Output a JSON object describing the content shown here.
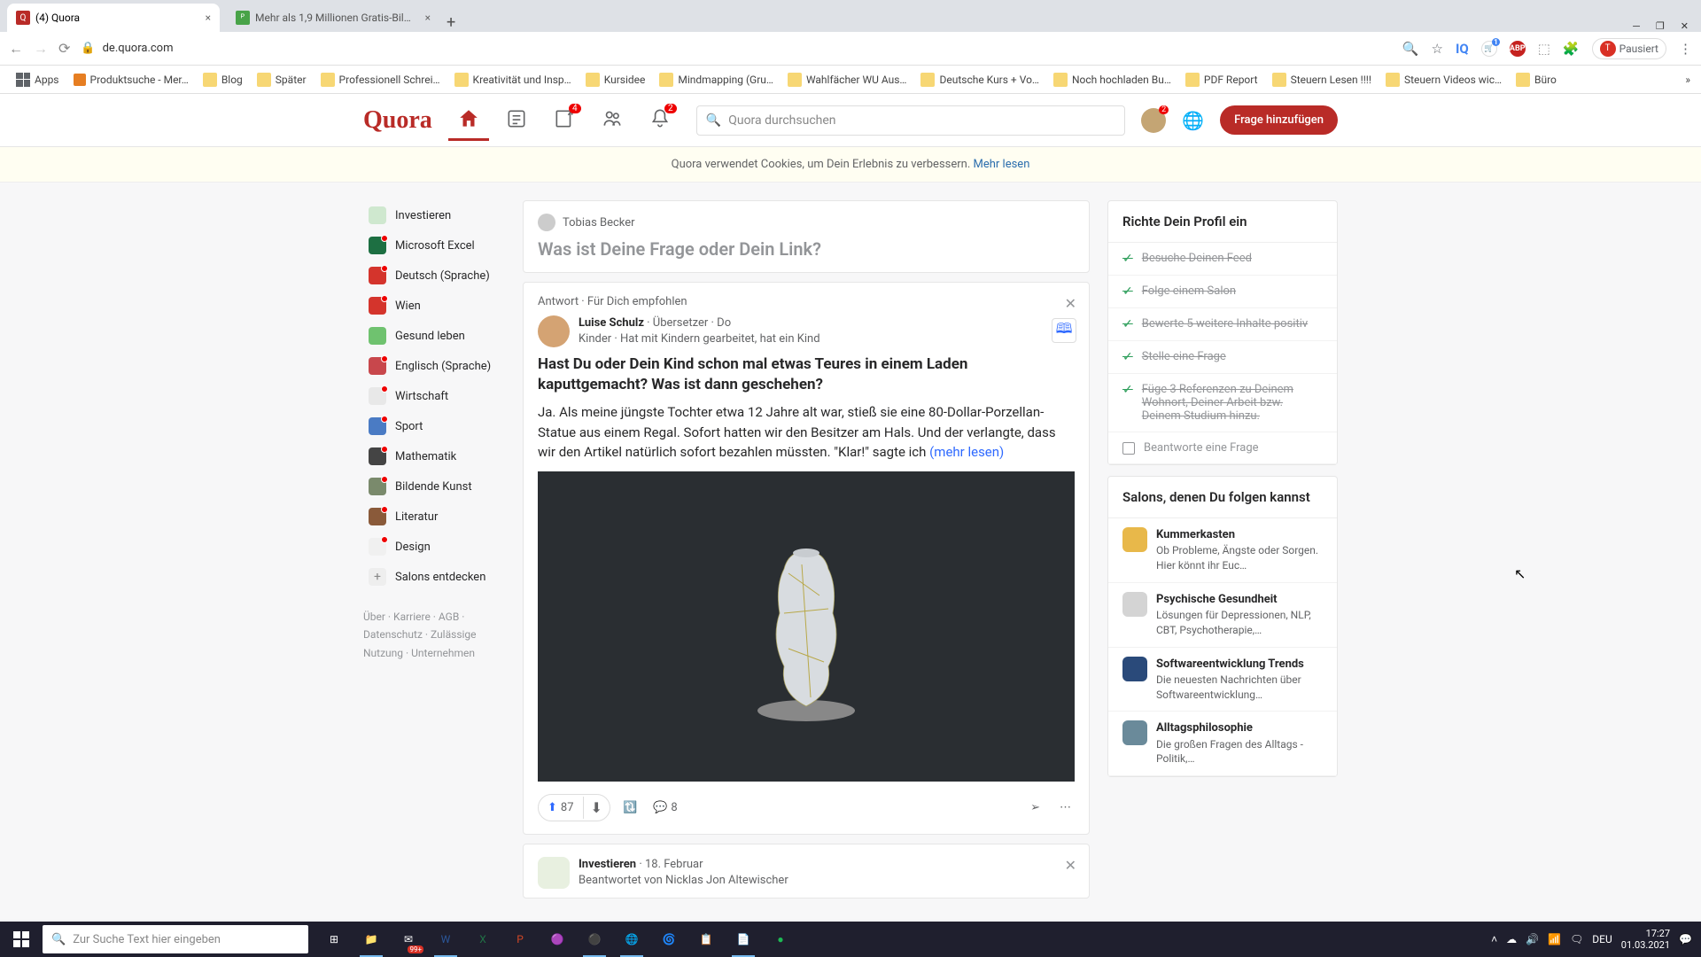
{
  "tabs": [
    {
      "title": "(4) Quora",
      "active": true
    },
    {
      "title": "Mehr als 1,9 Millionen Gratis-Bil…",
      "active": false
    }
  ],
  "url": "de.quora.com",
  "paused": "Pausiert",
  "bookmarks": [
    "Apps",
    "Produktsuche - Mer…",
    "Blog",
    "Später",
    "Professionell Schrei…",
    "Kreativität und Insp…",
    "Kursidee",
    "Mindmapping  (Gru…",
    "Wahlfächer WU Aus…",
    "Deutsche Kurs + Vo…",
    "Noch hochladen Bu…",
    "PDF Report",
    "Steuern Lesen !!!!",
    "Steuern Videos wic…",
    "Büro"
  ],
  "logo": "Quora",
  "nav_badges": {
    "edit": "4",
    "bell": "2",
    "profile": "2"
  },
  "search_placeholder": "Quora durchsuchen",
  "add_question": "Frage hinzufügen",
  "cookie": {
    "text": "Quora verwendet Cookies, um Dein Erlebnis zu verbessern.",
    "link": "Mehr lesen"
  },
  "spaces": [
    {
      "name": "Investieren",
      "color": "#cfe8cf",
      "dot": false
    },
    {
      "name": "Microsoft Excel",
      "color": "#1d6f42",
      "dot": true
    },
    {
      "name": "Deutsch (Sprache)",
      "color": "#d4342c",
      "dot": true
    },
    {
      "name": "Wien",
      "color": "#d4342c",
      "dot": true
    },
    {
      "name": "Gesund leben",
      "color": "#6fc26f",
      "dot": false
    },
    {
      "name": "Englisch (Sprache)",
      "color": "#c8474c",
      "dot": true
    },
    {
      "name": "Wirtschaft",
      "color": "#e8e8e8",
      "dot": true
    },
    {
      "name": "Sport",
      "color": "#4a7bc4",
      "dot": true
    },
    {
      "name": "Mathematik",
      "color": "#444",
      "dot": true
    },
    {
      "name": "Bildende Kunst",
      "color": "#7a8a6c",
      "dot": true
    },
    {
      "name": "Literatur",
      "color": "#8a5a3a",
      "dot": true
    },
    {
      "name": "Design",
      "color": "#f0f0f0",
      "dot": true
    }
  ],
  "discover": "Salons entdecken",
  "footer": "Über · Karriere · AGB · Datenschutz · Zulässige Nutzung · Unternehmen",
  "ask": {
    "user": "Tobias Becker",
    "prompt": "Was ist Deine Frage oder Dein Link?"
  },
  "feed": {
    "tag": "Antwort · Für Dich empfohlen",
    "author": "Luise Schulz",
    "meta": " · Übersetzer · Do",
    "meta2": "Kinder · Hat mit Kindern gearbeitet, hat ein Kind",
    "question": "Hast Du oder Dein Kind schon mal etwas Teures in einem Laden kaputtgemacht? Was ist dann geschehen?",
    "body": "Ja. Als meine jüngste Tochter etwa 12 Jahre alt war, stieß sie eine 80-Dollar-Porzellan-Statue aus einem Regal. Sofort hatten wir den Besitzer am Hals. Und der verlangte, dass wir den Artikel natürlich sofort bezahlen müssten. \"Klar!\" sagte ich ",
    "more": "(mehr lesen)",
    "upvotes": "87",
    "comments": "8"
  },
  "feed2": {
    "space": "Investieren",
    "date": " · 18. Februar",
    "by": "Beantwortet von Nicklas Jon Altewischer"
  },
  "profilePanel": {
    "title": "Richte Dein Profil ein",
    "items": [
      {
        "text": "Besuche Deinen Feed",
        "done": true
      },
      {
        "text": "Folge einem Salon",
        "done": true
      },
      {
        "text": "Bewerte 5 weitere Inhalte positiv",
        "done": true
      },
      {
        "text": "Stelle eine Frage",
        "done": true
      },
      {
        "text": "Füge 3 Referenzen zu Deinem Wohnort, Deiner Arbeit bzw. Deinem Studium hinzu.",
        "done": true
      },
      {
        "text": "Beantworte eine Frage",
        "done": false
      }
    ]
  },
  "salonsPanel": {
    "title": "Salons, denen Du folgen kannst",
    "items": [
      {
        "name": "Kummerkasten",
        "desc": "Ob Probleme, Ängste oder Sorgen. Hier könnt ihr Euc…",
        "color": "#e8b84a"
      },
      {
        "name": "Psychische Gesundheit",
        "desc": "Lösungen für Depressionen, NLP, CBT, Psychotherapie,…",
        "color": "#d4d4d4"
      },
      {
        "name": "Softwareentwicklung Trends",
        "desc": "Die neuesten Nachrichten über Softwareentwicklung…",
        "color": "#2a4a7a"
      },
      {
        "name": "Alltagsphilosophie",
        "desc": "Die großen Fragen des Alltags - Politik,…",
        "color": "#6a8a9a"
      }
    ]
  },
  "taskbar": {
    "search": "Zur Suche Text hier eingeben",
    "badge": "99+",
    "lang": "DEU",
    "time": "17:27",
    "date": "01.03.2021"
  }
}
